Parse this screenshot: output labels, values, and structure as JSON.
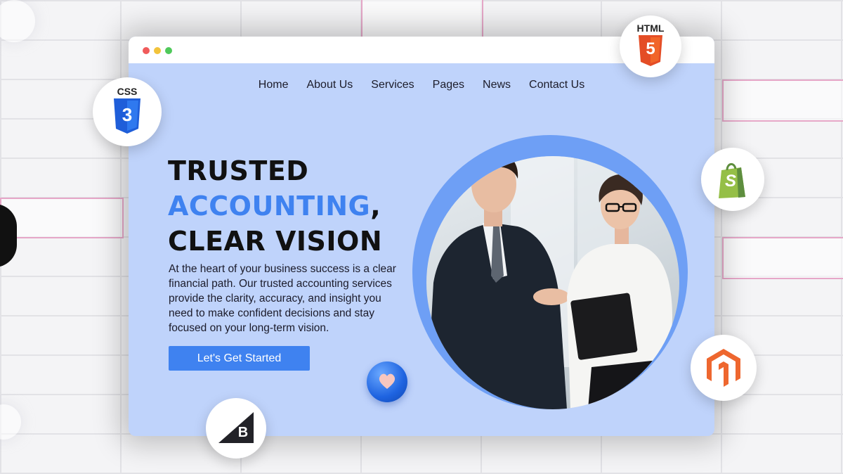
{
  "nav": {
    "items": [
      "Home",
      "About Us",
      "Services",
      "Pages",
      "News",
      "Contact Us"
    ]
  },
  "hero": {
    "line1": "TRUSTED",
    "line2_accent": "ACCOUNTING",
    "line2_suffix": ",",
    "line3": "CLEAR VISION",
    "description": "At the heart of your business success is a clear financial path. Our trusted accounting services provide the clarity, accuracy, and insight you need to make confident decisions and stay focused on your long-term vision.",
    "cta_label": "Let's Get Started"
  },
  "badges": {
    "html_label": "HTML",
    "html_number": "5",
    "css_label": "CSS",
    "css_number": "3",
    "shopify_letter": "S",
    "bigcommerce_letter": "B"
  },
  "colors": {
    "accent": "#3f82f0",
    "page_bg": "#bfd3fb",
    "html5": "#e44d26",
    "css3": "#1f5ed9",
    "shopify": "#95bf47",
    "magento": "#ee672f"
  },
  "icons": [
    "html5-icon",
    "css3-icon",
    "shopify-icon",
    "magento-icon",
    "bigcommerce-icon",
    "heart-icon"
  ]
}
